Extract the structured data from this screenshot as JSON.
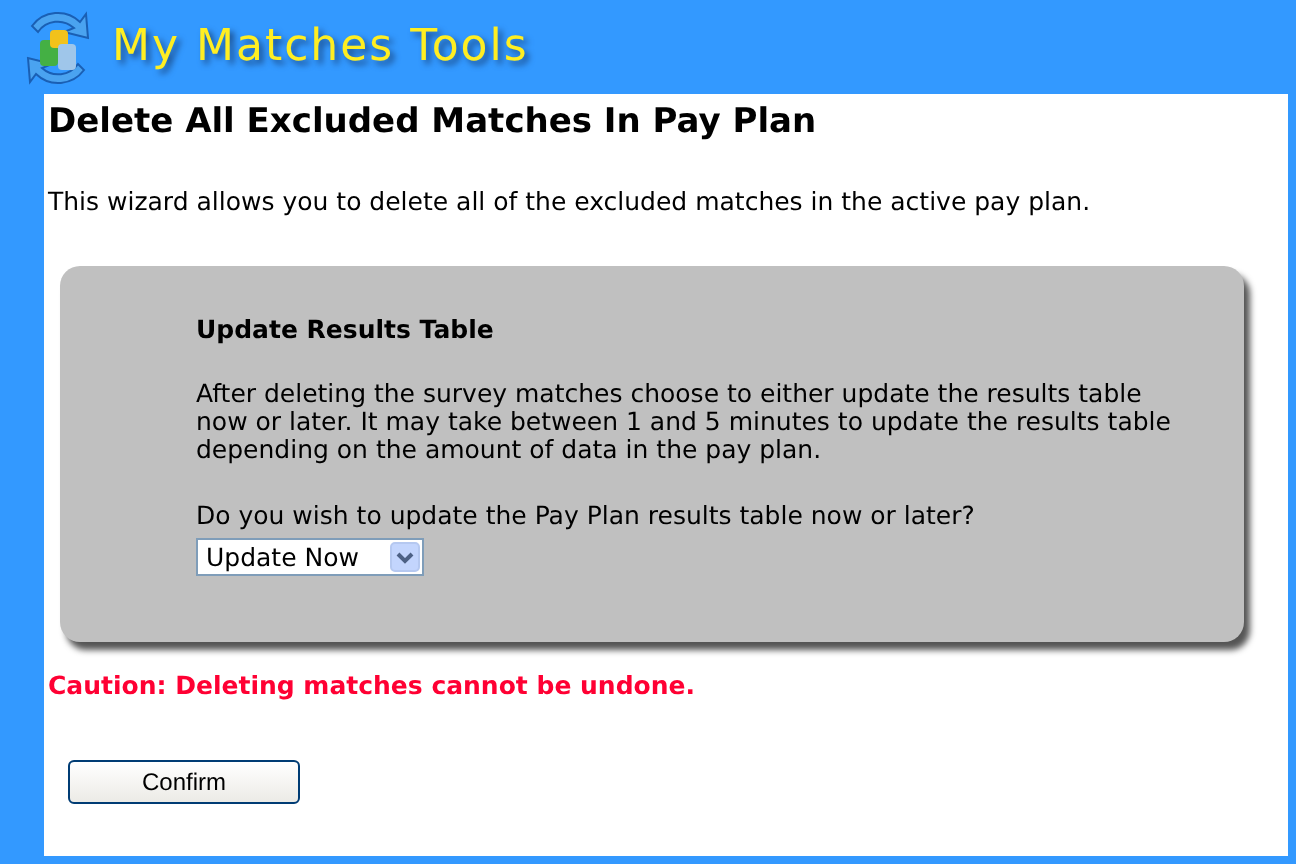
{
  "app": {
    "title": "My Matches Tools"
  },
  "page": {
    "heading": "Delete All Excluded Matches In Pay Plan",
    "intro": "This wizard allows you to delete all of the excluded matches in the active pay plan."
  },
  "panel": {
    "heading": "Update Results Table",
    "description": "After deleting the survey matches choose to either update the results table now or later.  It may take between 1 and 5 minutes to update the results table depending on the amount of data in the pay plan.",
    "question": "Do you wish to update the Pay Plan results table now or later?",
    "dropdown_value": "Update Now"
  },
  "caution": "Caution: Deleting matches cannot be undone.",
  "buttons": [
    "Confirm"
  ]
}
